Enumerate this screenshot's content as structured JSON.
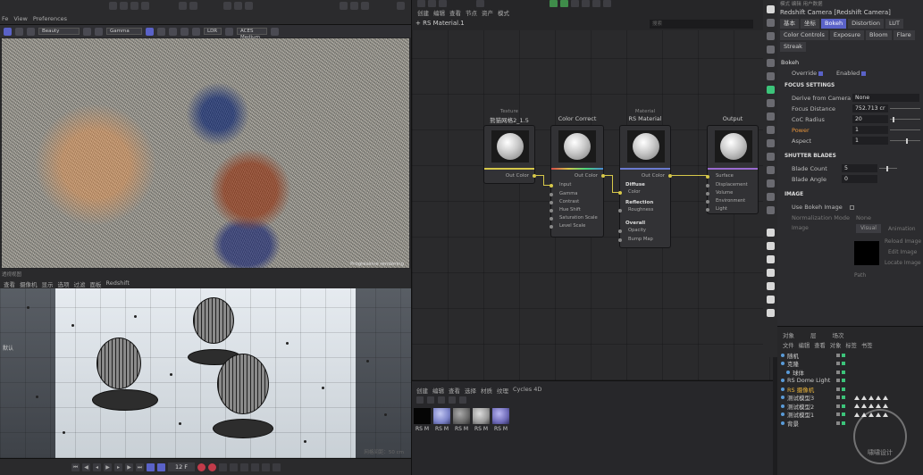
{
  "top_menu": [
    "Fe",
    "View",
    "Preferences"
  ],
  "render_view": {
    "toolbar_dropdowns": [
      "Beauty",
      "Gamma",
      "LDR",
      "ACES Medium"
    ],
    "caption": "Progressive rendering"
  },
  "viewport": {
    "menu": [
      "查看",
      "摄像机",
      "显示",
      "选项",
      "过滤",
      "面板",
      "Redshift"
    ],
    "label": "透视视图",
    "camera_label": "默认",
    "grid_caption": "网格间距：50 cm"
  },
  "timeline": {
    "frame": "12 F"
  },
  "node_editor": {
    "menu": [
      "创建",
      "编辑",
      "查看",
      "节点",
      "资产",
      "模式"
    ],
    "tab": "RS Material.1",
    "search_placeholder": "搜索",
    "nodes": {
      "texture": {
        "subtitle": "Texture",
        "title": "熊猫网格2_1.5",
        "out": "Out Color"
      },
      "color_correct": {
        "title": "Color Correct",
        "out": "Out Color",
        "inputs": [
          "Input",
          "Gamma",
          "Contrast",
          "Hue Shift",
          "Saturation Scale",
          "Level Scale"
        ]
      },
      "rs_material": {
        "subtitle": "Material",
        "title": "RS Material",
        "out": "Out Color",
        "sections": [
          {
            "name": "Diffuse",
            "items": [
              "Color"
            ]
          },
          {
            "name": "Reflection",
            "items": [
              "Roughness"
            ]
          },
          {
            "name": "Overall",
            "items": [
              "Opacity",
              "Bump Map"
            ]
          }
        ]
      },
      "output": {
        "title": "Output",
        "inputs": [
          "Surface",
          "Displacement",
          "Volume",
          "Environment",
          "Light"
        ]
      }
    }
  },
  "material_manager": {
    "menu": [
      "创建",
      "编辑",
      "查看",
      "选择",
      "材质",
      "纹理",
      "Cycles 4D"
    ],
    "materials": [
      {
        "name": "RS M",
        "color": "#050505"
      },
      {
        "name": "RS M",
        "color": "#7c83c9"
      },
      {
        "name": "RS M",
        "color": "#6a6a6a"
      },
      {
        "name": "RS M",
        "color": "#9a9a9a"
      },
      {
        "name": "RS M",
        "color": "#6e6ab8"
      }
    ]
  },
  "attributes": {
    "top": "模式  编辑  用户数据",
    "title": "Redshift Camera [Redshift Camera]",
    "tabs": [
      "基本",
      "坐标",
      "Bokeh",
      "Distortion",
      "LUT",
      "Color Controls",
      "Exposure",
      "Bloom",
      "Flare",
      "Streak"
    ],
    "active_tab": "Bokeh",
    "section": "Bokeh",
    "override_label": "Override",
    "enabled_label": "Enabled",
    "focus_header": "FOCUS SETTINGS",
    "derive_label": "Derive from Camera",
    "derive_value": "None",
    "focus_distance_label": "Focus Distance",
    "focus_distance_value": "752.713 cr",
    "coc_label": "CoC Radius",
    "coc_value": "20",
    "power_label": "Power",
    "power_value": "1",
    "aspect_label": "Aspect",
    "aspect_value": "1",
    "shutter_header": "SHUTTER BLADES",
    "blade_count_label": "Blade Count",
    "blade_count_value": "5",
    "blade_angle_label": "Blade Angle",
    "blade_angle_value": "0",
    "image_header": "IMAGE",
    "use_bokeh_label": "Use Bokeh Image",
    "norm_mode_label": "Normalization Mode",
    "norm_mode_value": "None",
    "image_label": "Image",
    "image_btn": "Visual",
    "animation_label": "Animation",
    "reload_label": "Reload Image",
    "edit_label": "Edit Image",
    "locate_label": "Locate Image",
    "path_label": "Path"
  },
  "object_manager": {
    "tabs": [
      "对象",
      "层",
      "场次"
    ],
    "menu": [
      "文件",
      "编辑",
      "查看",
      "对象",
      "标签",
      "书签"
    ],
    "items": [
      {
        "name": "随机",
        "highlight": false
      },
      {
        "name": "克隆",
        "highlight": false
      },
      {
        "name": "球体",
        "highlight": false
      },
      {
        "name": "RS Dome Light",
        "highlight": false
      },
      {
        "name": "RS 摄像机",
        "highlight": true
      },
      {
        "name": "测试模型3",
        "highlight": false
      },
      {
        "name": "测试模型2",
        "highlight": false
      },
      {
        "name": "测试模型1",
        "highlight": false
      },
      {
        "name": "背景",
        "highlight": false
      }
    ]
  },
  "watermark": "啸啸设计"
}
